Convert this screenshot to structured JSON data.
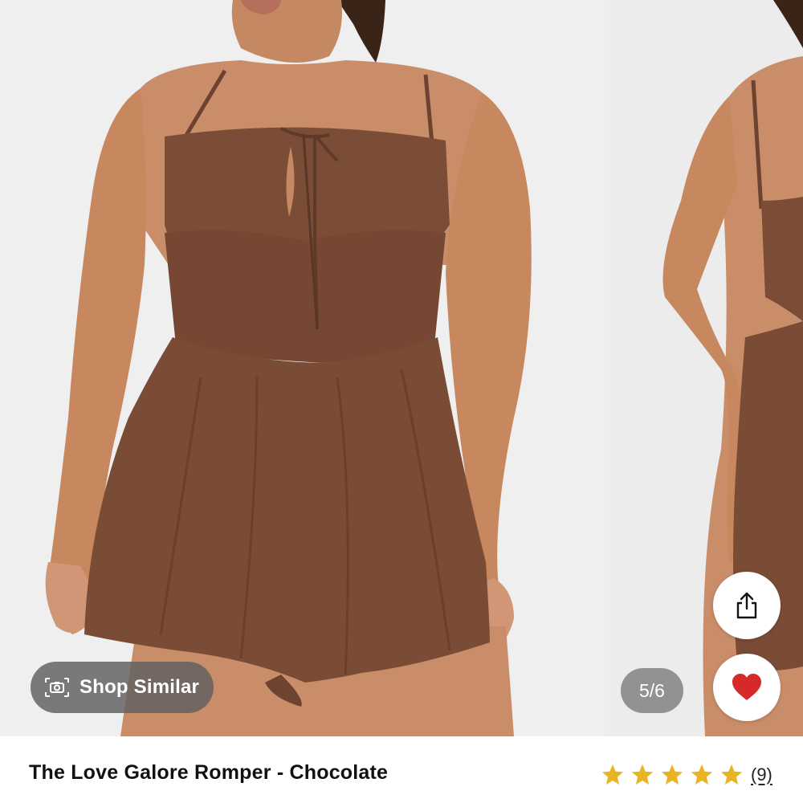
{
  "gallery": {
    "shop_similar_label": "Shop Similar",
    "image_counter": "5/6",
    "current_image": 5,
    "total_images": 6
  },
  "product": {
    "title": "The Love Galore Romper - Chocolate",
    "rating": 5,
    "rating_max": 5,
    "review_count": "(9)",
    "favorited": true
  },
  "icons": {
    "shop_similar": "camera-icon",
    "share": "share-icon",
    "favorite": "heart-icon",
    "rating": "star-icon"
  },
  "colors": {
    "fabric": "#7a4c35",
    "skin": "#c98d69",
    "heart": "#d62a2a",
    "star": "#e8b422",
    "backdrop": "#eeeeee"
  }
}
